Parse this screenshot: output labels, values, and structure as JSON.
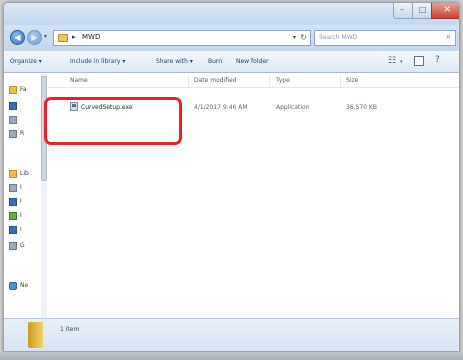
{
  "window": {
    "minimize_glyph": "–",
    "maximize_glyph": "□",
    "close_glyph": "×"
  },
  "address_bar": {
    "back_glyph": "◀",
    "forward_glyph": "▶",
    "path_arrow": "▸",
    "path": "MWD",
    "dropdown_glyph": "▾",
    "refresh_glyph": "↻",
    "search_placeholder": "Search MWD",
    "search_icon": "⌕"
  },
  "toolbar": {
    "organize": "Organize ▾",
    "include_in_library": "Include in library ▾",
    "share_with": "Share with ▾",
    "burn": "Burn",
    "new_folder": "New folder",
    "views_glyph": "☷",
    "views_drop": "▾",
    "help_glyph": "?"
  },
  "nav_pane": {
    "items": [
      {
        "label": "Fa",
        "icon": "favorites-star-icon"
      },
      {
        "label": "",
        "icon": "desktop-icon"
      },
      {
        "label": "",
        "icon": "downloads-icon"
      },
      {
        "label": "R",
        "icon": "recent-places-icon"
      },
      {
        "label": "Lib",
        "icon": "libraries-icon"
      },
      {
        "label": "I",
        "icon": "documents-icon"
      },
      {
        "label": "I",
        "icon": "music-icon"
      },
      {
        "label": "I",
        "icon": "pictures-icon"
      },
      {
        "label": "I",
        "icon": "videos-icon"
      },
      {
        "label": "G",
        "icon": "homegroup-icon"
      },
      {
        "label": "Ne",
        "icon": "network-icon"
      }
    ]
  },
  "list": {
    "columns": [
      "Name",
      "Date modified",
      "Type",
      "Size"
    ],
    "files": [
      {
        "name": "CurvedSetup.exe",
        "date_modified": "4/1/2017 9:46 AM",
        "type": "Application",
        "size": "36,570 KB",
        "icon": "setup-exe-icon"
      }
    ]
  },
  "details": {
    "item_count": "1 item"
  },
  "colors": {
    "highlight": "#e2232a",
    "titlebar": "#c3d7ef",
    "close_button": "#c8413a"
  }
}
